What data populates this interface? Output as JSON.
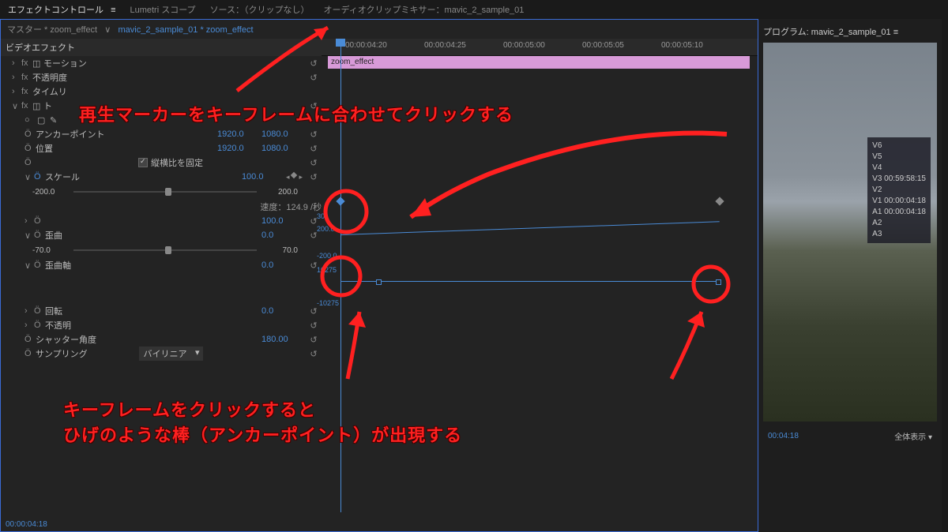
{
  "tabs": {
    "effect_controls": "エフェクトコントロール",
    "lumetri": "Lumetri スコープ",
    "source": "ソース：（クリップなし）",
    "audio_mixer": "オーディオクリップミキサー：mavic_2_sample_01"
  },
  "breadcrumb": {
    "master": "マスター * zoom_effect",
    "clip": "mavic_2_sample_01 * zoom_effect"
  },
  "sections": {
    "video_effects": "ビデオエフェクト",
    "motion": "モーション",
    "opacity": "不透明度",
    "time_remap": "タイムリ"
  },
  "transform": {
    "anchor_label": "アンカーポイント",
    "anchor_x": "1920.0",
    "anchor_y": "1080.0",
    "position_label": "位置",
    "position_x": "1920.0",
    "position_y": "1080.0",
    "uniform_label": "縦横比を固定",
    "scale_label": "スケール",
    "scale_val": "100.0",
    "slider_min": "-200.0",
    "slider_max": "200.0",
    "velocity_label": "速度：124.9 /秒",
    "axis_300": "30",
    "axis_200": "200.0",
    "axis_n200": "-200.0",
    "axis_10275": "10275",
    "axis_n10275": "-10275",
    "extra_100": "100.0",
    "skew_label": "歪曲",
    "skew_val": "0.0",
    "skew_min": "-70.0",
    "skew_max": "70.0",
    "skew_axis_label": "歪曲軸",
    "skew_axis_val": "0.0",
    "rotation_label": "回転",
    "rotation_val": "0.0",
    "opacity2_label": "不透明",
    "shutter_label": "シャッター角度",
    "shutter_val": "180.00",
    "sampling_label": "サンプリング",
    "sampling_val": "バイリニア"
  },
  "timeline": {
    "ticks": [
      "00:00:04:20",
      "00:00:04:25",
      "00:00:05:00",
      "00:00:05:05",
      "00:00:05:10"
    ],
    "clip_name": "zoom_effect",
    "current_tc": "00:00:04:18"
  },
  "program": {
    "title": "プログラム: mavic_2_sample_01",
    "tracks": [
      "V6",
      "V5",
      "V4",
      "V3 00:59:58:15",
      "V2",
      "V1 00:00:04:18",
      "A1 00:00:04:18",
      "A2",
      "A3"
    ],
    "tc": "00:04:18",
    "fit": "全体表示"
  },
  "annotations": {
    "line1": "再生マーカーをキーフレームに合わせてクリックする",
    "line2a": "キーフレームをクリックすると",
    "line2b": "ひげのような棒（アンカーポイント）が出現する"
  }
}
